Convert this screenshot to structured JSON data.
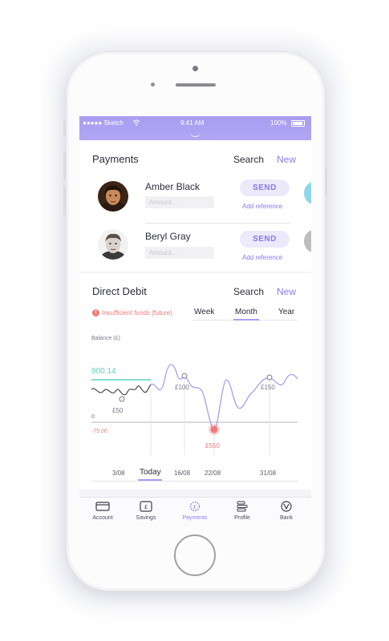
{
  "status_bar": {
    "carrier": "●●●●● Sketch",
    "time": "9:41 AM",
    "battery": "100%"
  },
  "payments": {
    "title": "Payments",
    "search": "Search",
    "new": "New",
    "contacts": [
      {
        "name": "Amber Black",
        "amount_placeholder": "Amount...",
        "send": "SEND",
        "add_reference": "Add reference"
      },
      {
        "name": "Beryl Gray",
        "amount_placeholder": "Amount...",
        "send": "SEND",
        "add_reference": "Add reference"
      }
    ]
  },
  "direct_debit": {
    "title": "Direct Debit",
    "search": "Search",
    "new": "New",
    "alert": "Insufficient funds (future)",
    "alert_icon": "!",
    "tabs": [
      "Week",
      "Month",
      "Year"
    ],
    "active_tab": "Month"
  },
  "chart_data": {
    "type": "line",
    "ylabel": "Balance (£)",
    "current_balance": "900.14",
    "zero_label": "0",
    "min_label": "-75.00",
    "annotations": [
      "£50",
      "£100",
      "£550",
      "£150"
    ],
    "x_ticks": [
      "3/08",
      "Today",
      "16/08",
      "22/08",
      "31/08"
    ],
    "active_tick": "Today",
    "colors": {
      "line": "#a99df2",
      "history": "#2b2d3a",
      "balance": "#5fd3c0",
      "negative": "#ef7a7a"
    }
  },
  "tab_bar": [
    {
      "label": "Account",
      "icon": "card-icon"
    },
    {
      "label": "Savings",
      "icon": "pound-wallet-icon"
    },
    {
      "label": "Payments",
      "icon": "pound-transfer-icon"
    },
    {
      "label": "Profile",
      "icon": "profile-icon"
    },
    {
      "label": "Bank",
      "icon": "bank-logo-icon"
    }
  ],
  "active_tab": "Payments"
}
